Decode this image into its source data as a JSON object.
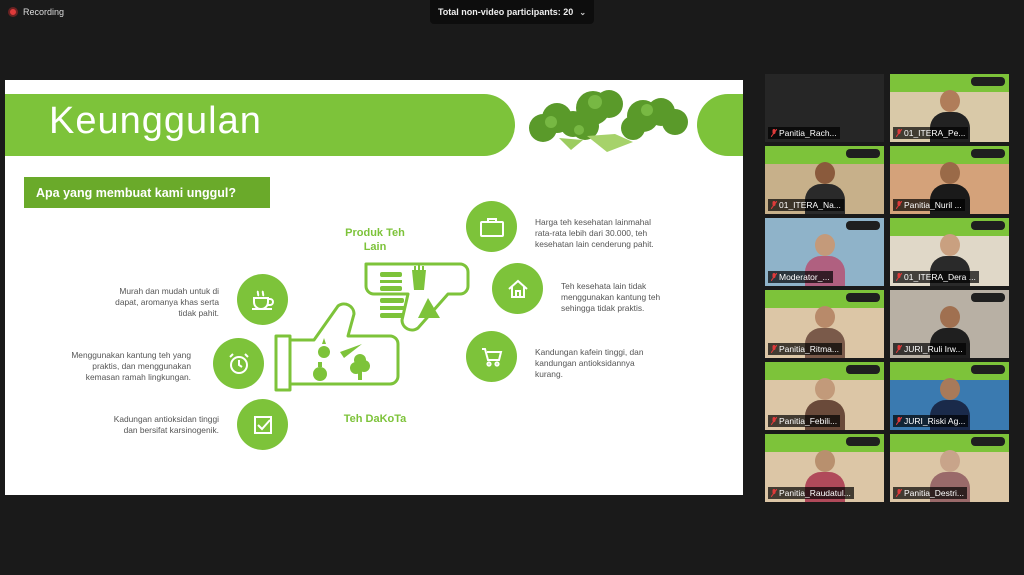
{
  "recording": {
    "label": "Recording"
  },
  "meeting": {
    "participants_label": "Total non-video participants: 20"
  },
  "slide": {
    "title": "Keunggulan",
    "question": "Apa yang membuat kami unggul?",
    "label_other": "Produk  Teh\nLain",
    "label_ours": "Teh DaKoTa",
    "left_notes": [
      "Murah dan mudah untuk di\ndapat, aromanya khas serta\ntidak pahit.",
      "Menggunakan kantung teh yang\npraktis, dan menggunakan\nkemasan ramah lingkungan.",
      "Kadungan antioksidan tinggi\ndan bersifat karsinogenik."
    ],
    "right_notes": [
      "Harga teh kesehatan lainmahal\nrata-rata lebih dari 30.000, teh\nkesehatan lain cenderung pahit.",
      "Teh kesehata lain tidak\nmenggunakan kantung teh\nsehingga tidak praktis.",
      "Kandungan kafein tinggi, dan\nkandungan antioksidannya\nkurang."
    ]
  },
  "participants": [
    {
      "name": "Panitia_Rach...",
      "skin": "#222222",
      "shirt": "#222222",
      "bg": "#262626"
    },
    {
      "name": "01_ITERA_Pe...",
      "skin": "#b07d5a",
      "shirt": "#222222",
      "bg": "#d9c9a8"
    },
    {
      "name": "01_ITERA_Na...",
      "skin": "#8a5a3c",
      "shirt": "#2a2a2a",
      "bg": "#c7b08a"
    },
    {
      "name": "Panitia_Nuril ...",
      "skin": "#9a6a48",
      "shirt": "#1a1a1a",
      "bg": "#d4a27a"
    },
    {
      "name": "Moderator_...",
      "skin": "#c49a7a",
      "shirt": "#b06080",
      "bg": "#8fb3c9"
    },
    {
      "name": "01_ITERA_Dera ...",
      "skin": "#c9a080",
      "shirt": "#2a2a2a",
      "bg": "#e0d8c8"
    },
    {
      "name": "Panitia_Ritma...",
      "skin": "#b88a6a",
      "shirt": "#7a5a4a",
      "bg": "#dcc6a6"
    },
    {
      "name": "JURI_Ruli Irw...",
      "skin": "#a07050",
      "shirt": "#1f1f1f",
      "bg": "#b8b0a4"
    },
    {
      "name": "Panitia_Febili...",
      "skin": "#c29a7a",
      "shirt": "#6a4a3a",
      "bg": "#dcc6a6"
    },
    {
      "name": "JURI_Riski Ag...",
      "skin": "#a87a5a",
      "shirt": "#1a2a4a",
      "bg": "#3a7ab0"
    },
    {
      "name": "Panitia_Raudatul...",
      "skin": "#b8906e",
      "shirt": "#b04a5a",
      "bg": "#dcc6a6"
    },
    {
      "name": "Panitia_Destri...",
      "skin": "#c8a48a",
      "shirt": "#9a6a6a",
      "bg": "#dcc6a6"
    }
  ],
  "icons": {
    "recording": "record-dot-icon",
    "left": [
      "tea-cup-icon",
      "alarm-clock-icon",
      "checkbox-icon"
    ],
    "right": [
      "briefcase-icon",
      "home-icon",
      "shopping-cart-icon"
    ]
  },
  "colors": {
    "brand_green": "#7dc33a",
    "recording_red": "#e03a3a",
    "active_speaker": "#e8d35a"
  }
}
